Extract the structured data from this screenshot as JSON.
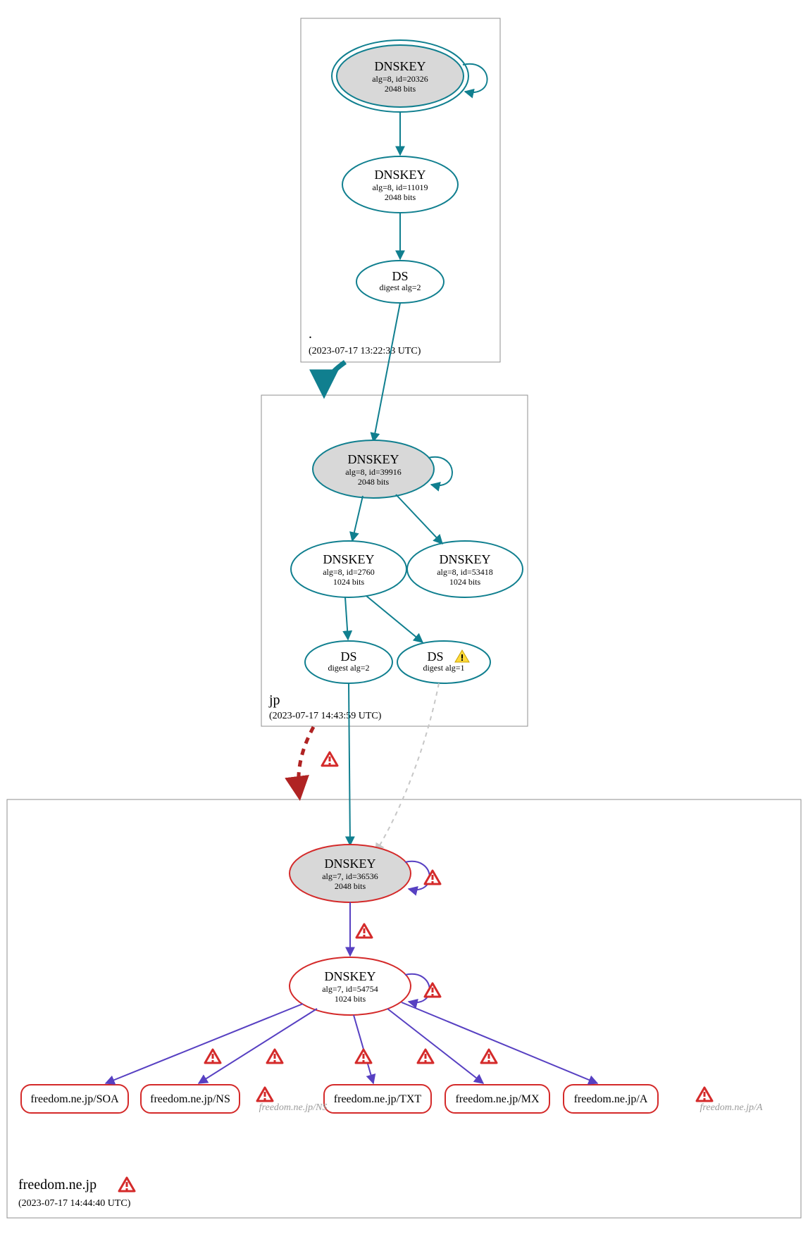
{
  "chart_data": {
    "type": "graph",
    "zones": [
      {
        "name": ".",
        "timestamp": "(2023-07-17 13:22:33 UTC)",
        "error": false
      },
      {
        "name": "jp",
        "timestamp": "(2023-07-17 14:43:59 UTC)",
        "error": false
      },
      {
        "name": "freedom.ne.jp",
        "timestamp": "(2023-07-17 14:44:40 UTC)",
        "error": true
      }
    ],
    "nodes": [
      {
        "id": "root-ksk",
        "zone": ".",
        "type": "DNSKEY",
        "title": "DNSKEY",
        "line1": "alg=8, id=20326",
        "line2": "2048 bits",
        "fill": "#d8d8d8",
        "stroke": "#107f8f",
        "double": true,
        "error": false,
        "warn": false
      },
      {
        "id": "root-zsk",
        "zone": ".",
        "type": "DNSKEY",
        "title": "DNSKEY",
        "line1": "alg=8, id=11019",
        "line2": "2048 bits",
        "fill": "#ffffff",
        "stroke": "#107f8f",
        "double": false,
        "error": false,
        "warn": false
      },
      {
        "id": "root-ds",
        "zone": ".",
        "type": "DS",
        "title": "DS",
        "line1": "digest alg=2",
        "line2": "",
        "fill": "#ffffff",
        "stroke": "#107f8f",
        "double": false,
        "error": false,
        "warn": false
      },
      {
        "id": "jp-ksk",
        "zone": "jp",
        "type": "DNSKEY",
        "title": "DNSKEY",
        "line1": "alg=8, id=39916",
        "line2": "2048 bits",
        "fill": "#d8d8d8",
        "stroke": "#107f8f",
        "double": false,
        "error": false,
        "warn": false
      },
      {
        "id": "jp-zsk1",
        "zone": "jp",
        "type": "DNSKEY",
        "title": "DNSKEY",
        "line1": "alg=8, id=2760",
        "line2": "1024 bits",
        "fill": "#ffffff",
        "stroke": "#107f8f",
        "double": false,
        "error": false,
        "warn": false
      },
      {
        "id": "jp-zsk2",
        "zone": "jp",
        "type": "DNSKEY",
        "title": "DNSKEY",
        "line1": "alg=8, id=53418",
        "line2": "1024 bits",
        "fill": "#ffffff",
        "stroke": "#107f8f",
        "double": false,
        "error": false,
        "warn": false
      },
      {
        "id": "jp-ds2",
        "zone": "jp",
        "type": "DS",
        "title": "DS",
        "line1": "digest alg=2",
        "line2": "",
        "fill": "#ffffff",
        "stroke": "#107f8f",
        "double": false,
        "error": false,
        "warn": false
      },
      {
        "id": "jp-ds1",
        "zone": "jp",
        "type": "DS",
        "title": "DS",
        "line1": "digest alg=1",
        "line2": "",
        "fill": "#ffffff",
        "stroke": "#107f8f",
        "double": false,
        "error": false,
        "warn": true
      },
      {
        "id": "fr-ksk",
        "zone": "freedom.ne.jp",
        "type": "DNSKEY",
        "title": "DNSKEY",
        "line1": "alg=7, id=36536",
        "line2": "2048 bits",
        "fill": "#d8d8d8",
        "stroke": "#d42a2a",
        "double": false,
        "error": false,
        "warn": false
      },
      {
        "id": "fr-zsk",
        "zone": "freedom.ne.jp",
        "type": "DNSKEY",
        "title": "DNSKEY",
        "line1": "alg=7, id=54754",
        "line2": "1024 bits",
        "fill": "#ffffff",
        "stroke": "#d42a2a",
        "double": false,
        "error": false,
        "warn": false
      }
    ],
    "rrsets": [
      {
        "id": "rr-soa",
        "label": "freedom.ne.jp/SOA"
      },
      {
        "id": "rr-ns",
        "label": "freedom.ne.jp/NS"
      },
      {
        "id": "rr-txt",
        "label": "freedom.ne.jp/TXT"
      },
      {
        "id": "rr-mx",
        "label": "freedom.ne.jp/MX"
      },
      {
        "id": "rr-a",
        "label": "freedom.ne.jp/A"
      }
    ],
    "ghosts": [
      {
        "id": "gh-ns",
        "label": "freedom.ne.jp/NS"
      },
      {
        "id": "gh-a",
        "label": "freedom.ne.jp/A"
      }
    ],
    "edges": [
      {
        "from": "root-ksk",
        "to": "root-ksk",
        "style": "self-teal"
      },
      {
        "from": "root-ksk",
        "to": "root-zsk",
        "style": "teal"
      },
      {
        "from": "root-zsk",
        "to": "root-ds",
        "style": "teal"
      },
      {
        "from": "root-ds",
        "to": "jp-ksk",
        "style": "teal"
      },
      {
        "from": ".",
        "to": "jp",
        "style": "thick-teal"
      },
      {
        "from": "jp-ksk",
        "to": "jp-ksk",
        "style": "self-teal"
      },
      {
        "from": "jp-ksk",
        "to": "jp-zsk1",
        "style": "teal"
      },
      {
        "from": "jp-ksk",
        "to": "jp-zsk2",
        "style": "teal"
      },
      {
        "from": "jp-zsk1",
        "to": "jp-ds2",
        "style": "teal"
      },
      {
        "from": "jp-zsk1",
        "to": "jp-ds1",
        "style": "teal"
      },
      {
        "from": "jp-ds2",
        "to": "fr-ksk",
        "style": "teal"
      },
      {
        "from": "jp-ds1",
        "to": "fr-ksk",
        "style": "gray-dash"
      },
      {
        "from": "jp",
        "to": "freedom.ne.jp",
        "style": "red-dash-thick",
        "error": true
      },
      {
        "from": "fr-ksk",
        "to": "fr-ksk",
        "style": "self-indigo",
        "error": true
      },
      {
        "from": "fr-ksk",
        "to": "fr-zsk",
        "style": "indigo",
        "error": true
      },
      {
        "from": "fr-zsk",
        "to": "fr-zsk",
        "style": "self-indigo",
        "error": true
      },
      {
        "from": "fr-zsk",
        "to": "rr-soa",
        "style": "indigo",
        "error": true
      },
      {
        "from": "fr-zsk",
        "to": "rr-ns",
        "style": "indigo",
        "error": true
      },
      {
        "from": "fr-zsk",
        "to": "rr-txt",
        "style": "indigo",
        "error": true
      },
      {
        "from": "fr-zsk",
        "to": "rr-mx",
        "style": "indigo",
        "error": true
      },
      {
        "from": "fr-zsk",
        "to": "rr-a",
        "style": "indigo",
        "error": true
      }
    ]
  },
  "colors": {
    "teal": "#107f8f",
    "indigo": "#5740c2",
    "red": "#d42a2a",
    "gray": "#c7c7c7",
    "box": "#8f8f8f"
  }
}
